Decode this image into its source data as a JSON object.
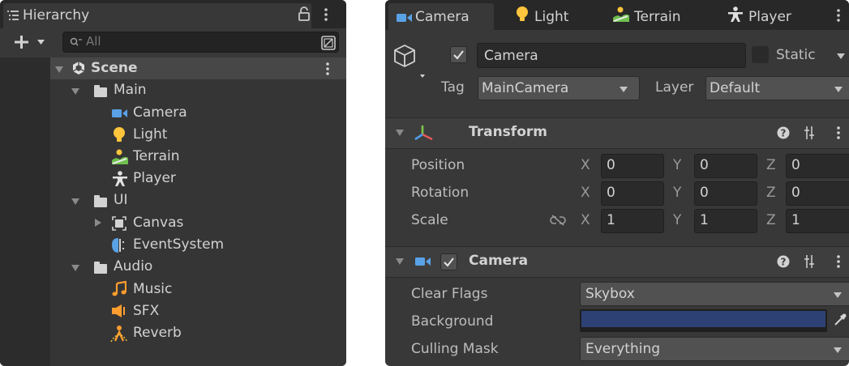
{
  "hierarchy": {
    "tab_title": "Hierarchy",
    "search_placeholder": "All",
    "items": [
      {
        "label": "Scene"
      },
      {
        "label": "Main"
      },
      {
        "label": "Camera"
      },
      {
        "label": "Light"
      },
      {
        "label": "Terrain"
      },
      {
        "label": "Player"
      },
      {
        "label": "UI"
      },
      {
        "label": "Canvas"
      },
      {
        "label": "EventSystem"
      },
      {
        "label": "Audio"
      },
      {
        "label": "Music"
      },
      {
        "label": "SFX"
      },
      {
        "label": "Reverb"
      }
    ]
  },
  "inspector": {
    "tabs": [
      {
        "label": "Camera"
      },
      {
        "label": "Light"
      },
      {
        "label": "Terrain"
      },
      {
        "label": "Player"
      }
    ],
    "object_name": "Camera",
    "static_label": "Static",
    "tag_label": "Tag",
    "tag_value": "MainCamera",
    "layer_label": "Layer",
    "layer_value": "Default",
    "transform": {
      "title": "Transform",
      "rows": [
        {
          "label": "Position",
          "x": "0",
          "y": "0",
          "z": "0"
        },
        {
          "label": "Rotation",
          "x": "0",
          "y": "0",
          "z": "0"
        },
        {
          "label": "Scale",
          "x": "1",
          "y": "1",
          "z": "1"
        }
      ],
      "axis_x": "X",
      "axis_y": "Y",
      "axis_z": "Z"
    },
    "camera": {
      "title": "Camera",
      "clear_flags_label": "Clear Flags",
      "clear_flags_value": "Skybox",
      "background_label": "Background",
      "background_color": "#2d4175",
      "culling_mask_label": "Culling Mask",
      "culling_mask_value": "Everything"
    }
  },
  "colors": {
    "panel_bg": "#383838",
    "tab_bar_bg": "#282828",
    "selected_row": "#474747",
    "camera_icon": "#5aa2e6",
    "light_icon": "#ffc53d",
    "terrain_green": "#6fc04e",
    "audio_orange": "#ff9d2e"
  }
}
